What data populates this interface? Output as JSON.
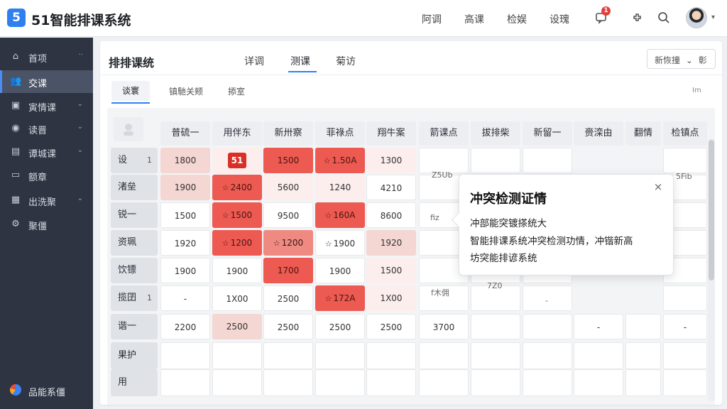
{
  "app": {
    "logo": "5",
    "title": "51智能排课系统"
  },
  "topnav": [
    "阿调",
    "高课",
    "检娱",
    "设瑰"
  ],
  "top_icons": {
    "notification_icon": "notification-icon",
    "notification_count": "1",
    "settings_icon": "puzzle-icon",
    "search_icon": "search-icon"
  },
  "sidebar": {
    "items": [
      {
        "icon": "home-icon",
        "label": "首项",
        "suffix": "··"
      },
      {
        "icon": "users-icon",
        "label": "交课",
        "suffix": ""
      },
      {
        "icon": "calendar-icon",
        "label": "寅情课",
        "suffix": "⌄"
      },
      {
        "icon": "user-icon",
        "label": "读晋",
        "suffix": "⌄"
      },
      {
        "icon": "book-icon",
        "label": "谭城课",
        "suffix": "⌄"
      },
      {
        "icon": "doc-icon",
        "label": "额章",
        "suffix": ""
      },
      {
        "icon": "building-icon",
        "label": "出洗聚",
        "suffix": "⌄"
      },
      {
        "icon": "gear-icon",
        "label": "聚僵",
        "suffix": ""
      }
    ],
    "footer": {
      "icon": "brand-icon",
      "label": "品能系僵"
    }
  },
  "main": {
    "title": "排排课统",
    "tabs": [
      "详调",
      "测课",
      "菊访"
    ],
    "active_tab": "测课",
    "select": {
      "value": "新恢撞",
      "caret": "⌄",
      "extra": "彰"
    },
    "subtabs": [
      "谈寰",
      "镇馳关颊",
      "掭室"
    ],
    "subtab_right": "Im"
  },
  "table": {
    "headers": [
      "普硫一",
      "用伴东",
      "新卅察",
      "菲祿点",
      "翔牛案",
      "箭课点",
      "拔排柴",
      "新留一",
      "赍滦由",
      "翻情",
      "检镇点"
    ],
    "rows": [
      {
        "label": "设",
        "sub": "1",
        "cells": [
          "1800",
          "51",
          "1500",
          "1.50A",
          "1300",
          "",
          "",
          "",
          "",
          "",
          ""
        ]
      },
      {
        "label": "渚垒",
        "sub": "",
        "cells": [
          "1900",
          "2400",
          "5600",
          "1240",
          "4210",
          "",
          "",
          "",
          "",
          "",
          ""
        ]
      },
      {
        "label": "锐一",
        "sub": "",
        "cells": [
          "1500",
          "1500",
          "9500",
          "160A",
          "8600",
          "",
          "",
          "",
          "",
          "",
          ""
        ]
      },
      {
        "label": "资珮",
        "sub": "",
        "cells": [
          "1920",
          "1200",
          "1200",
          "1900",
          "1920",
          "",
          "",
          "",
          "",
          "",
          ""
        ]
      },
      {
        "label": "饮镖",
        "sub": "",
        "cells": [
          "1900",
          "1900",
          "1700",
          "1900",
          "1500",
          "",
          "",
          "",
          "",
          "",
          ""
        ]
      },
      {
        "label": "揽囝",
        "sub": "1",
        "cells": [
          "-",
          "1X00",
          "2500",
          "172A",
          "1X00",
          "",
          "",
          "",
          "",
          "",
          ""
        ]
      },
      {
        "label": "谐一",
        "sub": "",
        "cells": [
          "2200",
          "2500",
          "2500",
          "2500",
          "2500",
          "3700",
          "",
          "",
          "-",
          "",
          "-"
        ]
      },
      {
        "label": "果护",
        "sub": "",
        "cells": [
          "",
          "",
          "",
          "",
          "",
          "",
          "",
          "",
          "",
          "",
          ""
        ]
      },
      {
        "label": "用",
        "sub": "",
        "cells": [
          "",
          "",
          "",
          "",
          "",
          "",
          "",
          "",
          "",
          "",
          ""
        ]
      }
    ],
    "floating": {
      "c6_top": "Z5Ub",
      "c6_mid": "fiz",
      "c6_low": "f木佣",
      "c7_low": "7Z0",
      "c8_low": "-",
      "c11_top": "5Fib"
    }
  },
  "popover": {
    "title": "冲突检测证情",
    "lines": [
      "冲部能突镀搽统大",
      "智能排课系统冲突检测功情，冲锴新高",
      "坊突能排谚系统"
    ],
    "close": "×"
  },
  "colors": {
    "accent": "#2f7ff0",
    "sidebar_bg": "#2e3442",
    "conflict_red": "#ec5a51",
    "conflict_mid": "#ee8a82",
    "pink": "#f4d6d2"
  }
}
